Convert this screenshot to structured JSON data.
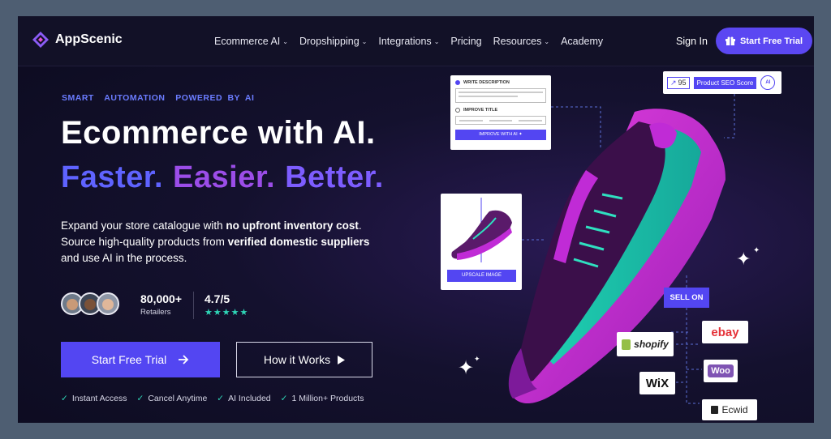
{
  "brand": {
    "name": "AppScenic"
  },
  "nav": {
    "items": [
      {
        "label": "Ecommerce AI",
        "dropdown": true
      },
      {
        "label": "Dropshipping",
        "dropdown": true
      },
      {
        "label": "Integrations",
        "dropdown": true
      },
      {
        "label": "Pricing",
        "dropdown": false
      },
      {
        "label": "Resources",
        "dropdown": true
      },
      {
        "label": "Academy",
        "dropdown": false
      }
    ],
    "sign_in": "Sign In",
    "trial": "Start Free Trial"
  },
  "hero": {
    "tagline": "SMART  AUTOMATION  POWERED BY AI",
    "headline": "Ecommerce with AI.",
    "words": [
      "Faster.",
      "Easier.",
      "Better."
    ],
    "desc_1": "Expand your store catalogue with ",
    "desc_b1": "no upfront inventory cost",
    "desc_2": ". Source high-quality products from ",
    "desc_b2": "verified domestic suppliers",
    "desc_3": " and use AI in the process.",
    "stat_retailers_value": "80,000+",
    "stat_retailers_label": "Retailers",
    "rating_value": "4.7/5",
    "rating_stars": 5,
    "cta_trial": "Start Free Trial",
    "cta_how": "How it Works",
    "checks": [
      "Instant Access",
      "Cancel Anytime",
      "AI Included",
      "1 Million+ Products"
    ]
  },
  "widgets": {
    "write_description": "WRITE DESCRIPTION",
    "improve_title": "IMPROVE TITLE",
    "improve_ai": "IMPROVE WITH AI ✦",
    "upscale": "UPSCALE IMAGE",
    "seo_score": "95",
    "seo_label": "Product SEO Score",
    "seo_ai": "AI",
    "sell_on": "SELL ON"
  },
  "marketplaces": [
    "shopify",
    "ebay",
    "WiX",
    "Woo",
    "Ecwid"
  ],
  "colors": {
    "accent": "#5346f2",
    "teal": "#2fd6b7",
    "magenta": "#c02bd6"
  }
}
